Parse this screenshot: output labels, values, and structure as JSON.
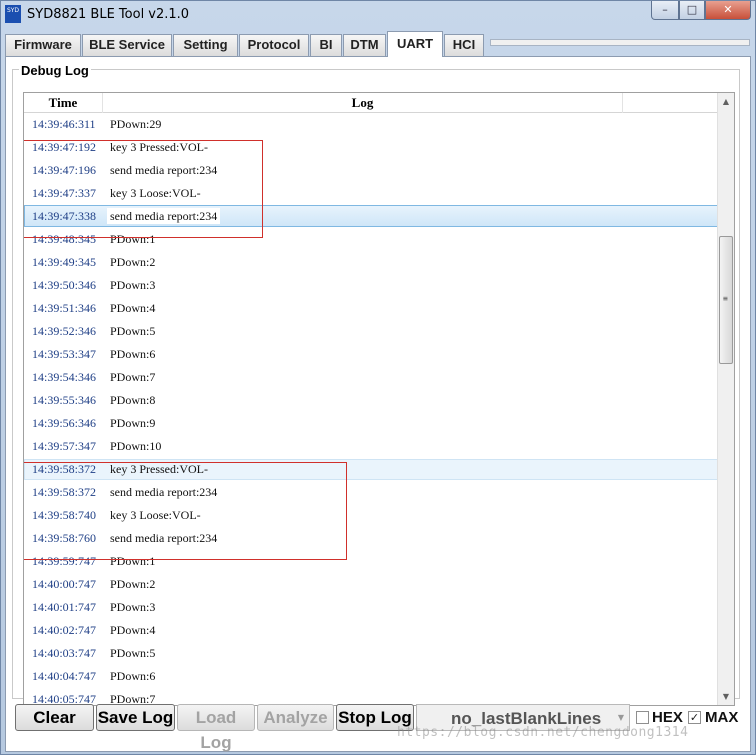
{
  "window": {
    "title": "SYD8821 BLE Tool v2.1.0",
    "app_icon_text": "SYD",
    "minimize_glyph": "–",
    "maximize_glyph": "□",
    "close_glyph": "✕"
  },
  "tabs": [
    {
      "label": "Firmware",
      "active": false
    },
    {
      "label": "BLE Service",
      "active": false
    },
    {
      "label": "Setting",
      "active": false
    },
    {
      "label": "Protocol",
      "active": false
    },
    {
      "label": "BI",
      "active": false
    },
    {
      "label": "DTM",
      "active": false
    },
    {
      "label": "UART",
      "active": true
    },
    {
      "label": "HCI",
      "active": false
    }
  ],
  "debug_log": {
    "title": "Debug Log",
    "columns": [
      "Time",
      "Log"
    ],
    "rows": [
      {
        "time": "14:39:46:311",
        "log": "PDown:29"
      },
      {
        "time": "14:39:47:192",
        "log": "key 3 Pressed:VOL-"
      },
      {
        "time": "14:39:47:196",
        "log": "send media report:234"
      },
      {
        "time": "14:39:47:337",
        "log": "key 3 Loose:VOL-"
      },
      {
        "time": "14:39:47:338",
        "log": "send media report:234",
        "selected": true
      },
      {
        "time": "14:39:48:345",
        "log": "PDown:1"
      },
      {
        "time": "14:39:49:345",
        "log": "PDown:2"
      },
      {
        "time": "14:39:50:346",
        "log": "PDown:3"
      },
      {
        "time": "14:39:51:346",
        "log": "PDown:4"
      },
      {
        "time": "14:39:52:346",
        "log": "PDown:5"
      },
      {
        "time": "14:39:53:347",
        "log": "PDown:6"
      },
      {
        "time": "14:39:54:346",
        "log": "PDown:7"
      },
      {
        "time": "14:39:55:346",
        "log": "PDown:8"
      },
      {
        "time": "14:39:56:346",
        "log": "PDown:9"
      },
      {
        "time": "14:39:57:347",
        "log": "PDown:10"
      },
      {
        "time": "14:39:58:372",
        "log": "key 3 Pressed:VOL-",
        "hover": true
      },
      {
        "time": "14:39:58:372",
        "log": "send media report:234"
      },
      {
        "time": "14:39:58:740",
        "log": "key 3 Loose:VOL-"
      },
      {
        "time": "14:39:58:760",
        "log": "send media report:234"
      },
      {
        "time": "14:39:59:747",
        "log": "PDown:1"
      },
      {
        "time": "14:40:00:747",
        "log": "PDown:2"
      },
      {
        "time": "14:40:01:747",
        "log": "PDown:3"
      },
      {
        "time": "14:40:02:747",
        "log": "PDown:4"
      },
      {
        "time": "14:40:03:747",
        "log": "PDown:5"
      },
      {
        "time": "14:40:04:747",
        "log": "PDown:6"
      },
      {
        "time": "14:40:05:747",
        "log": "PDown:7"
      }
    ]
  },
  "scrollbar": {
    "up_glyph": "▲",
    "down_glyph": "▼",
    "grip_glyph": "≡",
    "position_fraction": 0.28
  },
  "toolbar": {
    "clear_label": "Clear",
    "save_log_label": "Save Log",
    "load_log_label": "Load Log",
    "analyze_label": "Analyze",
    "stop_log_label": "Stop Log",
    "mode_value": "no_lastBlankLines",
    "combo_arrow": "▼",
    "hex_label": "HEX",
    "hex_checked": false,
    "max_label": "MAX",
    "max_checked": true,
    "check_glyph": "✓"
  },
  "watermark": "https://blog.csdn.net/chengdong1314",
  "colors": {
    "annotation_red": "#d0302b",
    "time_blue": "#1f3f86",
    "selection_blue": "#cfe6f8"
  }
}
